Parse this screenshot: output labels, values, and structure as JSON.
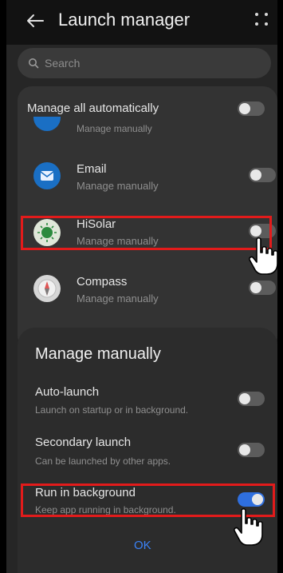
{
  "header": {
    "title": "Launch manager"
  },
  "search": {
    "placeholder": "Search"
  },
  "list": {
    "manage_all_label": "Manage all automatically",
    "partial_sub": "Manage manually",
    "apps": [
      {
        "name": "Email",
        "sub": "Manage manually",
        "enabled": false
      },
      {
        "name": "HiSolar",
        "sub": "Manage manually",
        "enabled": false
      },
      {
        "name": "Compass",
        "sub": "Manage manually",
        "enabled": false
      }
    ]
  },
  "sheet": {
    "title": "Manage manually",
    "options": [
      {
        "name": "Auto-launch",
        "sub": "Launch on startup or in background.",
        "enabled": false
      },
      {
        "name": "Secondary launch",
        "sub": "Can be launched by other apps.",
        "enabled": false
      },
      {
        "name": "Run in background",
        "sub": "Keep app running in background.",
        "enabled": true
      }
    ],
    "ok_label": "OK"
  },
  "colors": {
    "accent": "#2f6fde",
    "highlight": "#e21b1b",
    "background": "#262626"
  },
  "icons": [
    "back-arrow-icon",
    "more-icon",
    "search-icon",
    "email-icon",
    "hisolar-icon",
    "compass-icon",
    "hand-pointer-icon"
  ]
}
